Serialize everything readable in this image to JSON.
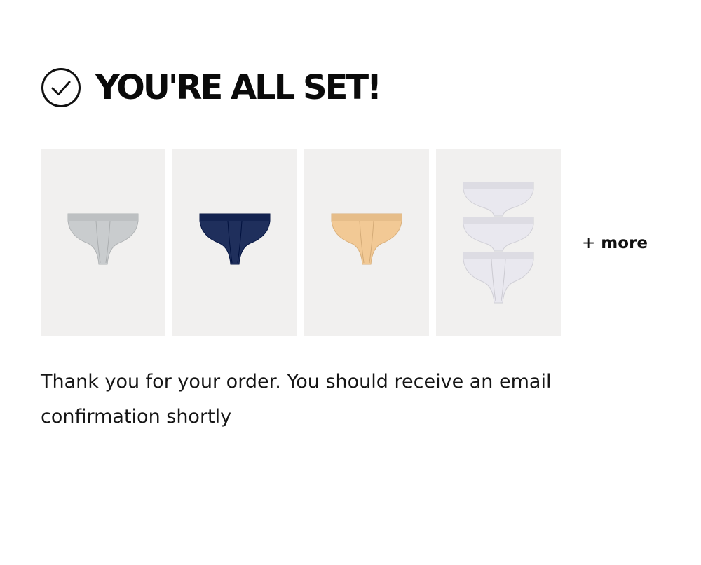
{
  "confirmation": {
    "title": "YOU'RE ALL SET!",
    "check_icon": "check-circle-icon"
  },
  "products": [
    {
      "name": "brief-grey",
      "color": "#c9ccce",
      "pack_count": 1
    },
    {
      "name": "brief-navy",
      "color": "#1f2f5c",
      "pack_count": 1
    },
    {
      "name": "brief-peach",
      "color": "#f2c995",
      "pack_count": 1
    },
    {
      "name": "brief-white-3-pack",
      "color": "#e9e8ef",
      "pack_count": 3
    }
  ],
  "more": {
    "plus": "+",
    "label": "more"
  },
  "message": "Thank you for your order. You should receive an email confirmation shortly",
  "colors": {
    "background": "#ffffff",
    "tile": "#f1f0ef",
    "text": "#111111"
  }
}
